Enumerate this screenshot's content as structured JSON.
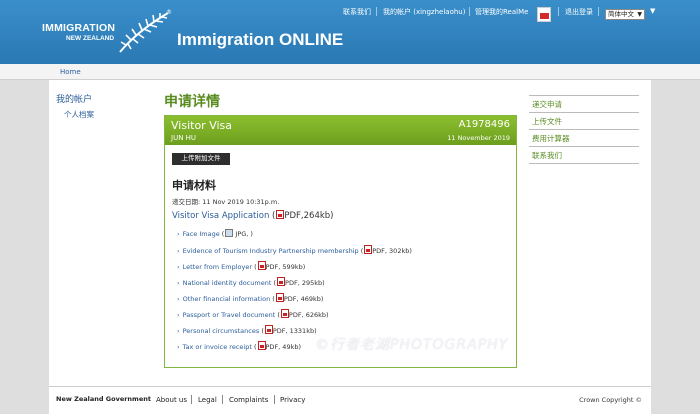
{
  "header": {
    "logo_line1": "IMMIGRATION",
    "logo_line2": "NEW ZEALAND",
    "registered": "®",
    "app_title": "Immigration ONLINE",
    "links": {
      "contact": "联系我们",
      "my_account": "我的帐户 (xingzhelaohu)",
      "manage_realme": "管理我的RealMe",
      "logout": "退出登录"
    },
    "language": "简体中文",
    "language_caret": "▼"
  },
  "breadcrumb": {
    "home": "Home"
  },
  "left_nav": {
    "my_account": "我的帐户",
    "profile": "个人档案"
  },
  "main": {
    "page_title": "申请详情",
    "panel": {
      "visa_name": "Visitor Visa",
      "person": "JUN HU",
      "application_number": "A1978496",
      "application_date": "11 November 2019"
    },
    "upload_button": "上传附加文件",
    "materials_title": "申请材料",
    "submit_date": "递交日期:  11 Nov 2019  10:31p.m.",
    "main_document": {
      "label": "Visitor Visa Application",
      "open": " (",
      "meta": "PDF,264kb)"
    },
    "documents": [
      {
        "label": "Face Image",
        "icon": "image-icon",
        "meta": " JPG, )"
      },
      {
        "label": "Evidence of Tourism Industry Partnership membership",
        "icon": "pdf-icon",
        "meta": "PDF, 302kb)"
      },
      {
        "label": "Letter from Employer",
        "icon": "pdf-icon",
        "meta": "PDF, 599kb)"
      },
      {
        "label": "National identity document",
        "icon": "pdf-icon",
        "meta": "PDF, 295kb)"
      },
      {
        "label": "Other financial information",
        "icon": "pdf-icon",
        "meta": "PDF, 469kb)"
      },
      {
        "label": "Passport or Travel document",
        "icon": "pdf-icon",
        "meta": "PDF, 626kb)"
      },
      {
        "label": "Personal circumstances",
        "icon": "pdf-icon",
        "meta": "PDF, 1331kb)"
      },
      {
        "label": "Tax or invoice receipt",
        "icon": "pdf-icon",
        "meta": "PDF, 49kb)"
      }
    ]
  },
  "right_nav": [
    "递交申请",
    "上传文件",
    "费用计算器",
    "联系我们"
  ],
  "watermark": "©行者老湖PHOTOGRAPHY",
  "footer": {
    "government": "New Zealand Government",
    "links": [
      "About us",
      "Legal",
      "Complaints",
      "Privacy"
    ],
    "copyright": "Crown Copyright ©"
  },
  "colors": {
    "header_blue": "#2f84c1",
    "accent_green": "#6d9e1e",
    "link_blue": "#2b5d9a"
  }
}
